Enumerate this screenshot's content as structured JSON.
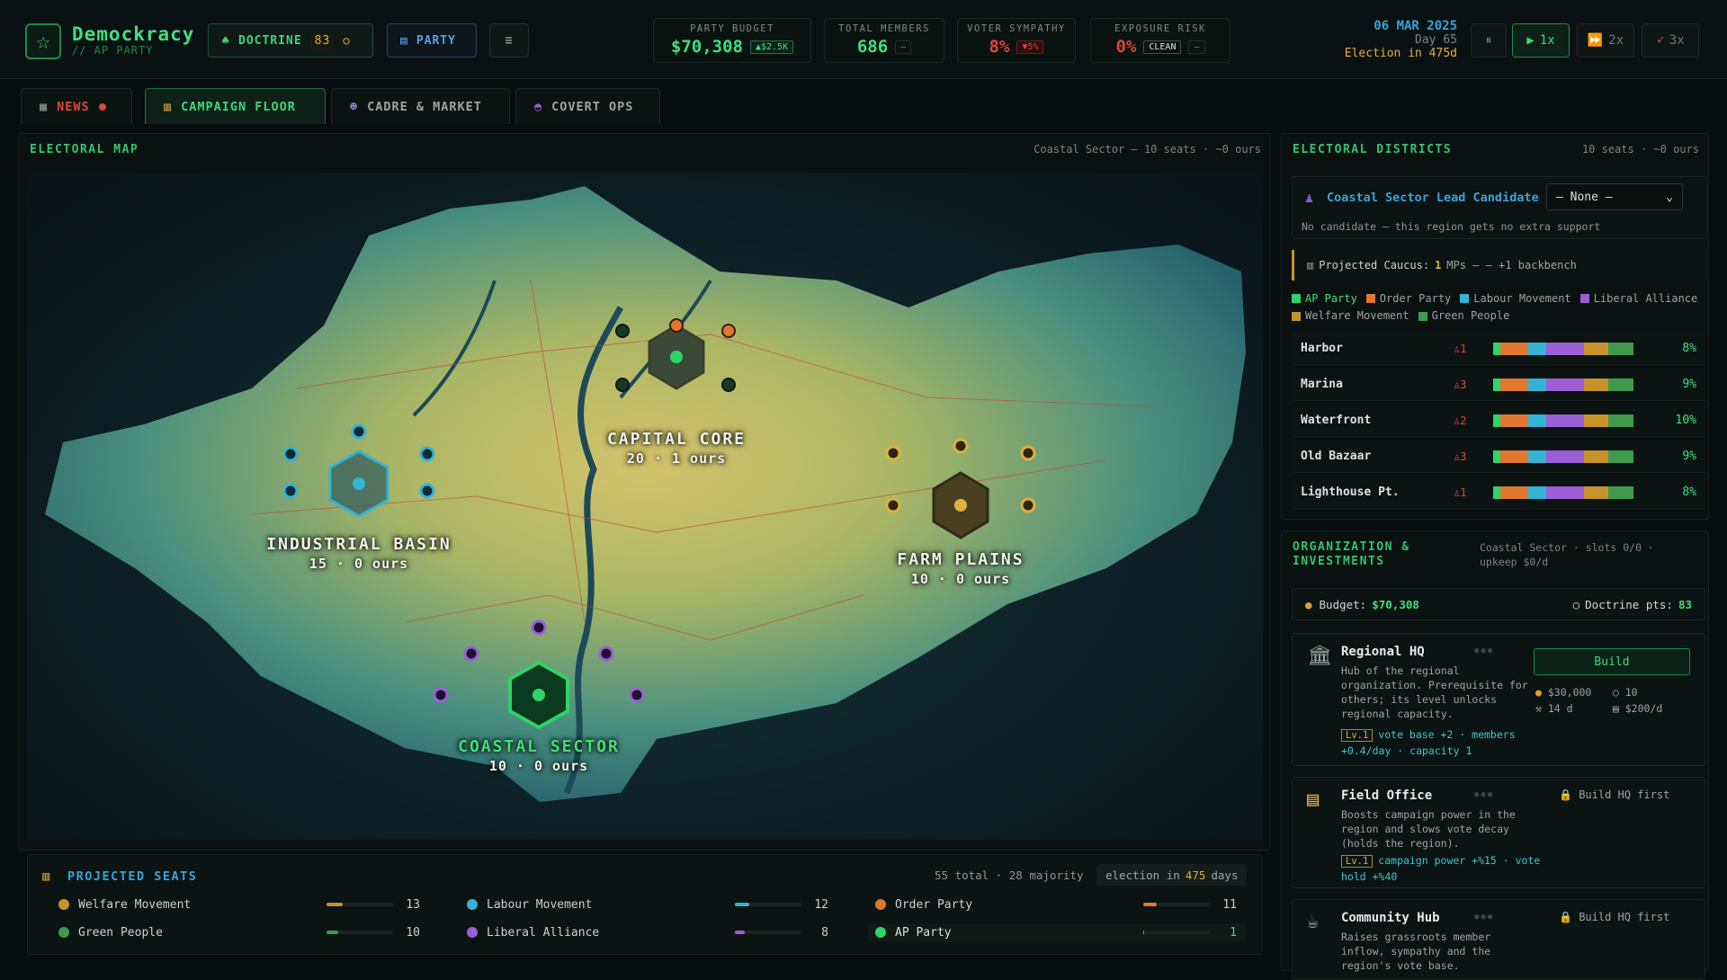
{
  "brand": {
    "name": "Demockracy",
    "sub": "// AP PARTY"
  },
  "top": {
    "doctrine_label": "DOCTRINE",
    "doctrine_count": "83",
    "party_label": "PARTY",
    "menu_icon": "menu-icon",
    "stats": [
      {
        "label": "PARTY BUDGET",
        "value": "$70,308",
        "pill": "▲$2.5K",
        "color": "#3fe07c"
      },
      {
        "label": "TOTAL MEMBERS",
        "value": "686",
        "pill": "–",
        "color": "#3fe07c"
      },
      {
        "label": "VOTER SYMPATHY",
        "value": "8%",
        "pill": "▼5%",
        "color": "#e0433b"
      },
      {
        "label": "EXPOSURE RISK",
        "value": "0%",
        "pill": "CLEAN",
        "pill2": "–",
        "color": "#e0433b"
      }
    ],
    "date": "06 MAR 2025",
    "day": "Day 65",
    "election": "Election in 475d",
    "speed": {
      "pause": "⏸",
      "s1": "1x",
      "s2": "2x",
      "s3": "3x"
    }
  },
  "tabs": [
    {
      "label": "NEWS",
      "icon": "news-icon"
    },
    {
      "label": "CAMPAIGN FLOOR",
      "icon": "chart-icon"
    },
    {
      "label": "CADRE & MARKET",
      "icon": "people-icon"
    },
    {
      "label": "COVERT OPS",
      "icon": "mask-icon"
    }
  ],
  "map": {
    "title": "ELECTORAL MAP",
    "subtitle": "Coastal Sector — 10 seats · ~0 ours",
    "regions": [
      {
        "name": "CAPITAL CORE",
        "seats": "20 · 1 ours"
      },
      {
        "name": "INDUSTRIAL BASIN",
        "seats": "15 · 0 ours"
      },
      {
        "name": "FARM PLAINS",
        "seats": "10 · 0 ours"
      },
      {
        "name": "COASTAL SECTOR",
        "seats": "10 · 0 ours"
      }
    ]
  },
  "seats": {
    "title": "PROJECTED SEATS",
    "summary": "55 total · 28 majority",
    "election_prefix": "election in",
    "election_days": "475",
    "election_suffix": "days",
    "parties": [
      {
        "name": "Welfare Movement",
        "seats": "13",
        "color": "#c8922a",
        "fill": 0.24
      },
      {
        "name": "Labour Movement",
        "seats": "12",
        "color": "#34b3d6",
        "fill": 0.22
      },
      {
        "name": "Order Party",
        "seats": "11",
        "color": "#e0782f",
        "fill": 0.2
      },
      {
        "name": "Green People",
        "seats": "10",
        "color": "#3f9a4e",
        "fill": 0.18
      },
      {
        "name": "Liberal Alliance",
        "seats": "8",
        "color": "#9a5fd6",
        "fill": 0.15
      },
      {
        "name": "AP Party",
        "seats": "1",
        "color": "#2ed36a",
        "fill": 0.02
      }
    ]
  },
  "districts": {
    "title": "ELECTORAL DISTRICTS",
    "subtitle": "10 seats · ~0 ours",
    "lead_label": "Coastal Sector Lead Candidate",
    "lead_value": "— None —",
    "lead_note": "No candidate — this region gets no extra support",
    "caucus_prefix": "Projected Caucus:",
    "caucus_count": "1",
    "caucus_suffix": "MPs — — +1 backbench",
    "legend": [
      {
        "name": "AP Party",
        "color": "#2ed36a"
      },
      {
        "name": "Order Party",
        "color": "#e0782f"
      },
      {
        "name": "Labour Movement",
        "color": "#34b3d6"
      },
      {
        "name": "Liberal Alliance",
        "color": "#9a5fd6"
      },
      {
        "name": "Welfare Movement",
        "color": "#c8922a"
      },
      {
        "name": "Green People",
        "color": "#3f9a4e"
      }
    ],
    "rows": [
      {
        "name": "Harbor",
        "mps": "1",
        "pct": "8%"
      },
      {
        "name": "Marina",
        "mps": "3",
        "pct": "9%"
      },
      {
        "name": "Waterfront",
        "mps": "2",
        "pct": "10%"
      },
      {
        "name": "Old Bazaar",
        "mps": "3",
        "pct": "9%"
      },
      {
        "name": "Lighthouse Pt.",
        "mps": "1",
        "pct": "8%"
      }
    ]
  },
  "org": {
    "title": "ORGANIZATION & INVESTMENTS",
    "subtitle": "Coastal Sector · slots 0/0 · upkeep $0/d",
    "budget_label": "Budget:",
    "budget": "$70,308",
    "doctrine_label": "Doctrine pts:",
    "doctrine": "83",
    "items": [
      {
        "title": "Regional HQ",
        "desc": "Hub of the regional organization. Prerequisite for others; its level unlocks regional capacity.",
        "lvl": "Lv.1",
        "effect": "vote base +2 · members +0.4/day · capacity 1",
        "action": "Build",
        "cost": "$30,000",
        "pts": "10",
        "time": "14 d",
        "upkeep": "$200/d"
      },
      {
        "title": "Field Office",
        "desc": "Boosts campaign power in the region and slows vote decay (holds the region).",
        "lvl": "Lv.1",
        "effect": "campaign power +%15 · vote hold +%40",
        "action": "Build HQ first"
      },
      {
        "title": "Community Hub",
        "desc": "Raises grassroots member inflow, sympathy and the region's vote base.",
        "action": "Build HQ first"
      }
    ]
  }
}
